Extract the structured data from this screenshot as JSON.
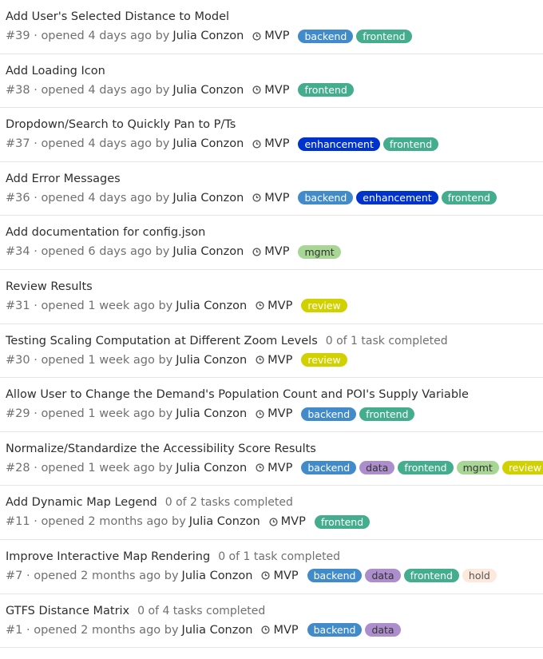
{
  "label_colors": {
    "backend": {
      "bg": "#428bca",
      "fg": "#ffffff"
    },
    "frontend": {
      "bg": "#44ad8e",
      "fg": "#ffffff"
    },
    "enhancement": {
      "bg": "#0033cc",
      "fg": "#ffffff"
    },
    "mgmt": {
      "bg": "#a8d695",
      "fg": "#333333"
    },
    "review": {
      "bg": "#d1d100",
      "fg": "#ffffff"
    },
    "data": {
      "bg": "#ad8ecc",
      "fg": "#333333"
    },
    "hold": {
      "bg": "#fde9dc",
      "fg": "#555555"
    }
  },
  "milestone_icon": "clock-icon",
  "issues": [
    {
      "title": "Add User's Selected Distance to Model",
      "tasks": "",
      "ref": "#39",
      "opened": "opened 4 days ago by",
      "author": "Julia Conzon",
      "milestone": "MVP",
      "labels": [
        "backend",
        "frontend"
      ]
    },
    {
      "title": "Add Loading Icon",
      "tasks": "",
      "ref": "#38",
      "opened": "opened 4 days ago by",
      "author": "Julia Conzon",
      "milestone": "MVP",
      "labels": [
        "frontend"
      ]
    },
    {
      "title": "Dropdown/Search to Quickly Pan to P/Ts",
      "tasks": "",
      "ref": "#37",
      "opened": "opened 4 days ago by",
      "author": "Julia Conzon",
      "milestone": "MVP",
      "labels": [
        "enhancement",
        "frontend"
      ]
    },
    {
      "title": "Add Error Messages",
      "tasks": "",
      "ref": "#36",
      "opened": "opened 4 days ago by",
      "author": "Julia Conzon",
      "milestone": "MVP",
      "labels": [
        "backend",
        "enhancement",
        "frontend"
      ]
    },
    {
      "title": "Add documentation for config.json",
      "tasks": "",
      "ref": "#34",
      "opened": "opened 6 days ago by",
      "author": "Julia Conzon",
      "milestone": "MVP",
      "labels": [
        "mgmt"
      ]
    },
    {
      "title": "Review Results",
      "tasks": "",
      "ref": "#31",
      "opened": "opened 1 week ago by",
      "author": "Julia Conzon",
      "milestone": "MVP",
      "labels": [
        "review"
      ]
    },
    {
      "title": "Testing Scaling Computation at Different Zoom Levels",
      "tasks": "0 of 1 task completed",
      "ref": "#30",
      "opened": "opened 1 week ago by",
      "author": "Julia Conzon",
      "milestone": "MVP",
      "labels": [
        "review"
      ]
    },
    {
      "title": "Allow User to Change the Demand's Population Count and POI's Supply Variable",
      "tasks": "",
      "ref": "#29",
      "opened": "opened 1 week ago by",
      "author": "Julia Conzon",
      "milestone": "MVP",
      "labels": [
        "backend",
        "frontend"
      ]
    },
    {
      "title": "Normalize/Standardize the Accessibility Score Results",
      "tasks": "",
      "ref": "#28",
      "opened": "opened 1 week ago by",
      "author": "Julia Conzon",
      "milestone": "MVP",
      "labels": [
        "backend",
        "data",
        "frontend",
        "mgmt",
        "review"
      ]
    },
    {
      "title": "Add Dynamic Map Legend",
      "tasks": "0 of 2 tasks completed",
      "ref": "#11",
      "opened": "opened 2 months ago by",
      "author": "Julia Conzon",
      "milestone": "MVP",
      "labels": [
        "frontend"
      ]
    },
    {
      "title": "Improve Interactive Map Rendering",
      "tasks": "0 of 1 task completed",
      "ref": "#7",
      "opened": "opened 2 months ago by",
      "author": "Julia Conzon",
      "milestone": "MVP",
      "labels": [
        "backend",
        "data",
        "frontend",
        "hold"
      ]
    },
    {
      "title": "GTFS Distance Matrix",
      "tasks": "0 of 4 tasks completed",
      "ref": "#1",
      "opened": "opened 2 months ago by",
      "author": "Julia Conzon",
      "milestone": "MVP",
      "labels": [
        "backend",
        "data"
      ]
    }
  ]
}
